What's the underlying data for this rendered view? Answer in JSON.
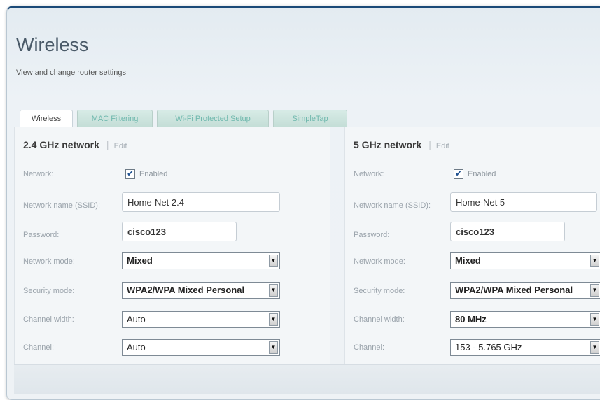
{
  "page": {
    "title": "Wireless",
    "subtitle": "View and change router settings"
  },
  "tabs": [
    {
      "label": "Wireless",
      "active": true
    },
    {
      "label": "MAC Filtering",
      "active": false
    },
    {
      "label": "Wi-Fi Protected Setup",
      "active": false
    },
    {
      "label": "SimpleTap",
      "active": false
    }
  ],
  "labels": {
    "network": "Network:",
    "ssid": "Network name (SSID):",
    "password": "Password:",
    "network_mode": "Network mode:",
    "security_mode": "Security mode:",
    "channel_width": "Channel width:",
    "channel": "Channel:",
    "enabled": "Enabled",
    "edit": "Edit",
    "separator": "|"
  },
  "net24": {
    "heading": "2.4 GHz network",
    "enabled": true,
    "ssid": "Home-Net 2.4",
    "password": "cisco123",
    "network_mode": "Mixed",
    "security_mode": "WPA2/WPA Mixed Personal",
    "channel_width": "Auto",
    "channel": "Auto"
  },
  "net5": {
    "heading": "5 GHz network",
    "enabled": true,
    "ssid": "Home-Net 5",
    "password": "cisco123",
    "network_mode": "Mixed",
    "security_mode": "WPA2/WPA Mixed Personal",
    "channel_width": "80 MHz",
    "channel": "153 - 5.765 GHz"
  },
  "colors": {
    "frame_top": "#1b4a78",
    "tab_inactive_text": "#6fb8ad",
    "checkmark": "#1e5090"
  },
  "icons": {
    "checkbox": "checkmark",
    "select_arrow": "down-triangle"
  }
}
